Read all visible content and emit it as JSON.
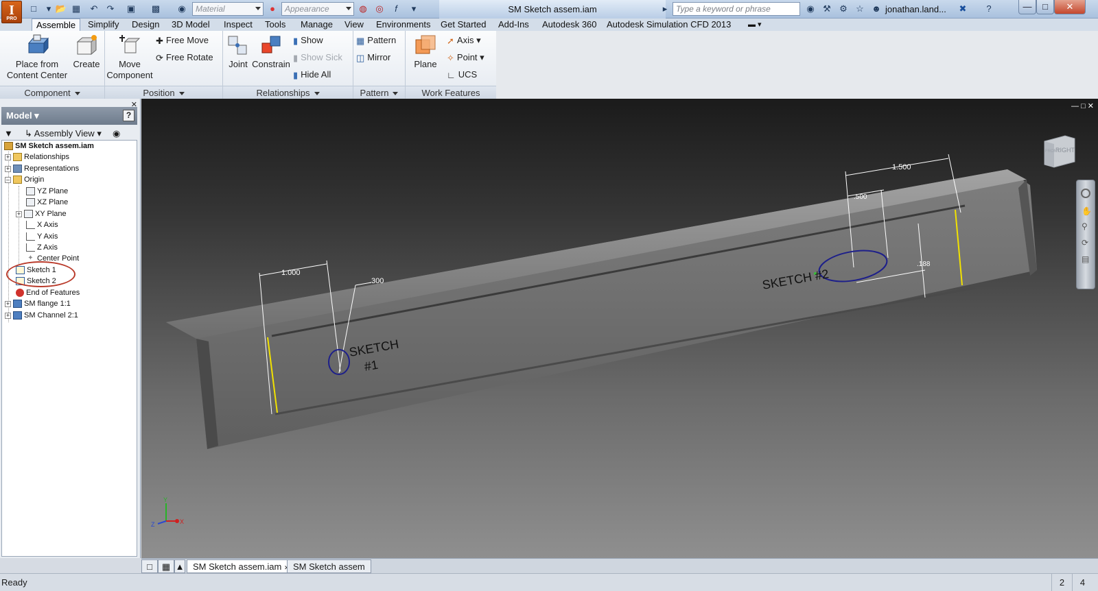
{
  "app": {
    "logo_letter": "I",
    "logo_sub": "PRO",
    "title": "SM Sketch assem.iam",
    "material_placeholder": "Material",
    "appearance_placeholder": "Appearance",
    "search_placeholder": "Type a keyword or phrase",
    "user": "jonathan.land..."
  },
  "tabs": [
    {
      "label": "Assemble",
      "active": true
    },
    {
      "label": "Simplify"
    },
    {
      "label": "Design"
    },
    {
      "label": "3D Model"
    },
    {
      "label": "Inspect"
    },
    {
      "label": "Tools"
    },
    {
      "label": "Manage"
    },
    {
      "label": "View"
    },
    {
      "label": "Environments"
    },
    {
      "label": "Get Started"
    },
    {
      "label": "Add-Ins"
    },
    {
      "label": "Autodesk 360"
    },
    {
      "label": "Autodesk Simulation CFD 2013"
    }
  ],
  "ribbon": {
    "component": {
      "title": "Component",
      "place_line1": "Place from",
      "place_line2": "Content Center",
      "create": "Create"
    },
    "position": {
      "title": "Position",
      "move_line1": "Move",
      "move_line2": "Component",
      "free_move": "Free Move",
      "free_rotate": "Free Rotate"
    },
    "relationships": {
      "title": "Relationships",
      "joint": "Joint",
      "constrain": "Constrain",
      "show": "Show",
      "show_sick": "Show Sick",
      "hide_all": "Hide All"
    },
    "pattern": {
      "title": "Pattern",
      "pattern": "Pattern",
      "mirror": "Mirror"
    },
    "work_features": {
      "title": "Work Features",
      "plane": "Plane",
      "axis": "Axis",
      "point": "Point",
      "ucs": "UCS"
    }
  },
  "browser": {
    "title": "Model",
    "help": "?",
    "view": "Assembly View",
    "tree": {
      "root": "SM Sketch assem.iam",
      "relationships": "Relationships",
      "representations": "Representations",
      "origin": "Origin",
      "yz": "YZ Plane",
      "xz": "XZ Plane",
      "xy": "XY Plane",
      "xaxis": "X Axis",
      "yaxis": "Y Axis",
      "zaxis": "Z Axis",
      "center": "Center Point",
      "sketch1": "Sketch 1",
      "sketch2": "Sketch 2",
      "eof": "End of Features",
      "flange": "SM flange 1:1",
      "channel": "SM Channel 2:1"
    }
  },
  "viewport": {
    "sketch1_line1": "SKETCH",
    "sketch1_line2": "#1",
    "sketch2": "SKETCH #2",
    "dim_1000": "1.000",
    "dim_300": ".300",
    "dim_1500": "1.500",
    "dim_500": ".500",
    "dim_188": ".188",
    "viewcube_right": "RIGHT",
    "viewcube_front": "FRONT",
    "axis_x": "X",
    "axis_y": "Y",
    "axis_z": "Z"
  },
  "doc_tabs": [
    {
      "label": "SM Sketch assem.iam",
      "active": true
    },
    {
      "label": "SM Sketch assem"
    }
  ],
  "status": {
    "text": "Ready",
    "n1": "2",
    "n2": "4"
  },
  "colors": {
    "accent": "#1f4e8c",
    "highlight_ring": "#c0392b",
    "sketch_curve": "#1d1f8a",
    "edge_yellow": "#f2e200"
  }
}
